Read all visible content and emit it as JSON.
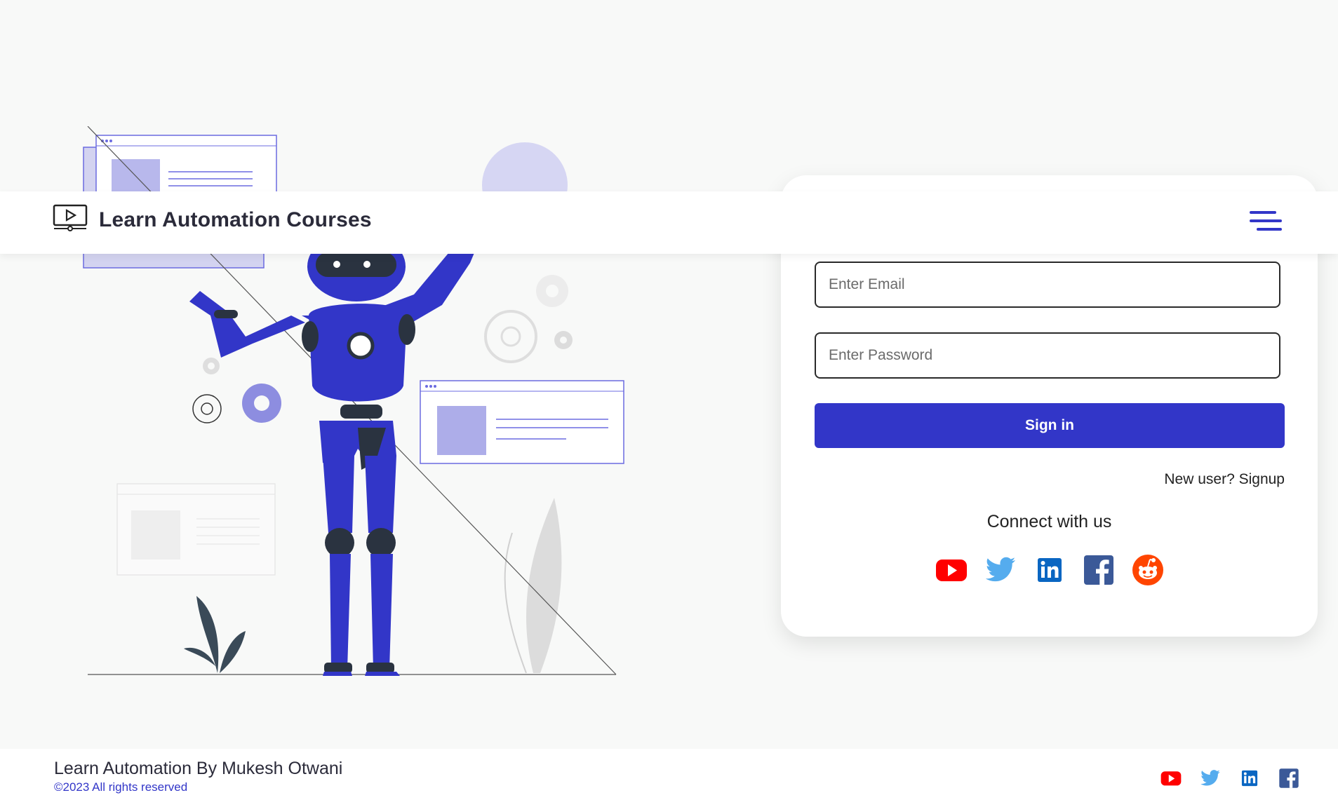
{
  "header": {
    "title": "Learn Automation Courses",
    "logo_icon": "play-monitor-icon",
    "menu_icon": "hamburger-menu-icon"
  },
  "login": {
    "email_placeholder": "Enter Email",
    "password_placeholder": "Enter Password",
    "signin_label": "Sign in",
    "signup_label": "New user? Signup",
    "connect_label": "Connect with us",
    "socials": [
      "youtube-icon",
      "twitter-icon",
      "linkedin-icon",
      "facebook-icon",
      "reddit-icon"
    ]
  },
  "footer": {
    "title": "Learn Automation By Mukesh Otwani",
    "copyright": "©2023 All rights reserved",
    "socials": [
      "youtube-icon",
      "twitter-icon",
      "linkedin-icon",
      "facebook-icon"
    ]
  },
  "colors": {
    "accent": "#3236c8",
    "youtube": "#ff0000",
    "twitter": "#55acee",
    "linkedin": "#0a66c2",
    "facebook": "#3b5998",
    "reddit": "#ff4500"
  }
}
